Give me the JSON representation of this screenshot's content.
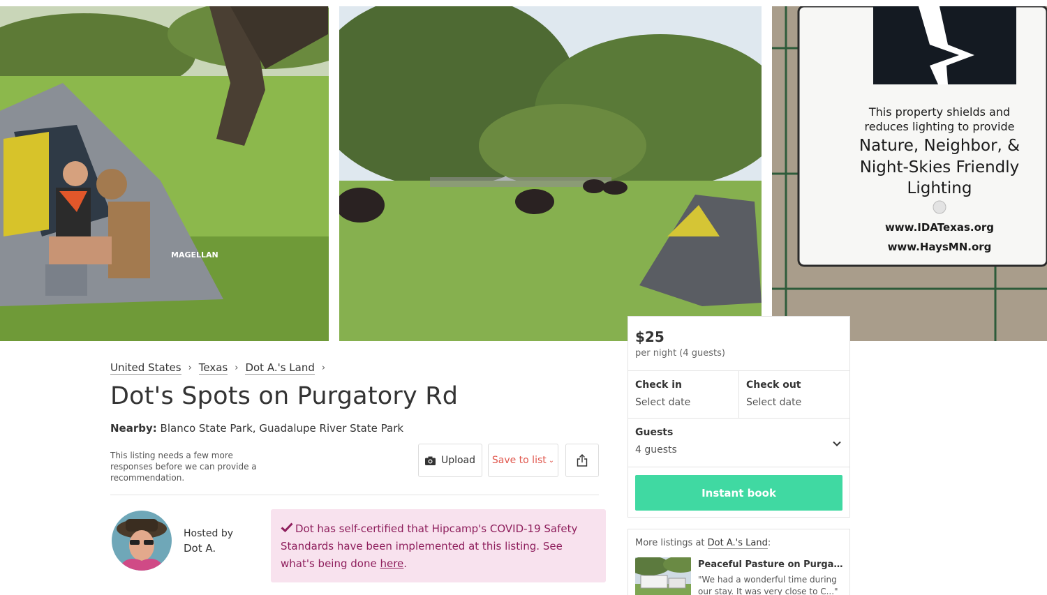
{
  "gallery": {
    "photo3_sign_lines": [
      "This property shields and",
      "reduces lighting to provide",
      "Nature, Neighbor, &",
      "Night-Skies Friendly",
      "Lighting",
      "www.IDATexas.org",
      "www.HaysMN.org"
    ],
    "tent_brand": "MAGELLAN"
  },
  "breadcrumb": [
    {
      "label": "United States"
    },
    {
      "label": "Texas"
    },
    {
      "label": "Dot A.'s Land"
    }
  ],
  "listing": {
    "title": "Dot's Spots on Purgatory Rd",
    "nearby_label": "Nearby:",
    "nearby_value": "Blanco State Park, Guadalupe River State Park",
    "recommendation_note": "This listing needs a few more responses before we can provide a recommendation."
  },
  "actions": {
    "upload_label": "Upload",
    "save_label": "Save to list"
  },
  "host": {
    "hosted_by_label": "Hosted by",
    "name": "Dot A."
  },
  "covid": {
    "text": "Dot has self-certified that Hipcamp's COVID-19 Safety Standards have been implemented at this listing. See what's being done ",
    "link_label": "here",
    "end": "."
  },
  "booking": {
    "price": "$25",
    "per_night": "per night (4 guests)",
    "check_in_label": "Check in",
    "check_in_value": "Select date",
    "check_out_label": "Check out",
    "check_out_value": "Select date",
    "guests_label": "Guests",
    "guests_value": "4 guests",
    "book_button": "Instant book"
  },
  "more_listings": {
    "prefix": "More listings at ",
    "link": "Dot A.'s Land",
    "suffix": ":",
    "items": [
      {
        "name": "Peaceful Pasture on Purgat...",
        "quote": "\"We had a wonderful time during our stay. It was very close to C...\""
      }
    ]
  },
  "colors": {
    "accent_green": "#40d9a2",
    "save_red": "#e0564c",
    "covid_bg": "#f8e2ee",
    "covid_text": "#8e1e5c"
  }
}
